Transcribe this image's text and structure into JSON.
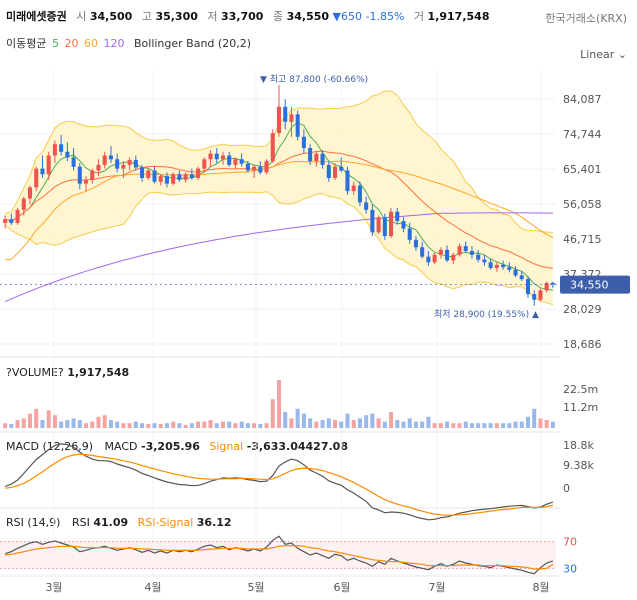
{
  "header": {
    "name": "미래에셋증권",
    "open_label": "시",
    "open": "34,500",
    "high_label": "고",
    "high": "35,300",
    "low_label": "저",
    "low": "33,700",
    "close_label": "종",
    "close": "34,550",
    "change": "▼650 -1.85%",
    "volume_label": "거",
    "volume": "1,917,548",
    "exchange": "한국거래소(KRX)"
  },
  "indicators": {
    "ma_title": "이동평균",
    "ma_periods": [
      "5",
      "20",
      "60",
      "120"
    ],
    "bollinger": "Bollinger Band (20,2)",
    "scale": "Linear",
    "volume_title": "?VOLUME?",
    "volume_value": "1,917,548",
    "macd_title": "MACD (12,26,9)",
    "macd_label": "MACD",
    "macd_value": "-3,205.96",
    "signal_label": "Signal",
    "signal_value": "-3,633.04427.08",
    "rsi_title": "RSI (14,9)",
    "rsi_label": "RSI",
    "rsi_value": "41.09",
    "rsi_signal_label": "RSI-Signal",
    "rsi_signal_value": "36.12"
  },
  "colors": {
    "up": "#ef5350",
    "down": "#2a6fdb",
    "ma5": "#4caf50",
    "ma20": "#ff7043",
    "ma60": "#ffa726",
    "ma120": "#a066f0",
    "band_fill": "#fff3c4",
    "band_line": "#f5cc4a",
    "signal_text": "#ff8a00",
    "price_tag": "#3d5ea8"
  },
  "chart_data": {
    "type": "candlestick",
    "x_labels": [
      "3월",
      "4월",
      "5월",
      "6월",
      "7월",
      "8월"
    ],
    "price_axis": [
      "84,087",
      "74,744",
      "65,401",
      "56,058",
      "46,715",
      "37,372",
      "28,029",
      "18,686"
    ],
    "current_price_tag": "34,550",
    "high_annotation": "▼ 최고 87,800 (-60.66%)",
    "low_annotation": "최저 28,900 (19.55%) ▲",
    "volume_axis": [
      "22.5m",
      "11.2m"
    ],
    "macd_axis": [
      "18.8k",
      "9.38k",
      "0"
    ],
    "rsi_axis": [
      "70",
      "30"
    ],
    "rsi_levels": [
      70,
      30
    ],
    "ylim": [
      18686,
      84087
    ],
    "candles": [
      [
        51000,
        53000,
        49500,
        52000
      ],
      [
        52000,
        53500,
        50500,
        51000
      ],
      [
        51000,
        55000,
        50500,
        54500
      ],
      [
        54500,
        58000,
        53000,
        57500
      ],
      [
        57500,
        61000,
        56000,
        60500
      ],
      [
        60500,
        66000,
        59500,
        65500
      ],
      [
        65500,
        69000,
        63000,
        64000
      ],
      [
        64000,
        70000,
        62500,
        69000
      ],
      [
        69000,
        73000,
        67000,
        72000
      ],
      [
        72000,
        74500,
        69000,
        70000
      ],
      [
        70000,
        72500,
        67500,
        68500
      ],
      [
        68500,
        71000,
        65000,
        66000
      ],
      [
        66000,
        67000,
        60000,
        61500
      ],
      [
        61500,
        63500,
        59500,
        62500
      ],
      [
        62500,
        65500,
        61500,
        65000
      ],
      [
        65000,
        68000,
        63500,
        66500
      ],
      [
        66500,
        70000,
        65500,
        69000
      ],
      [
        69000,
        71500,
        67000,
        68000
      ],
      [
        68000,
        69500,
        64500,
        65500
      ],
      [
        65500,
        67500,
        63000,
        66500
      ],
      [
        66500,
        68500,
        65000,
        67800
      ],
      [
        67800,
        69000,
        65000,
        65800
      ],
      [
        65800,
        66500,
        62000,
        63000
      ],
      [
        63000,
        65500,
        62500,
        65000
      ],
      [
        65000,
        66000,
        61500,
        62000
      ],
      [
        62000,
        64000,
        61000,
        63500
      ],
      [
        63500,
        64500,
        60500,
        61500
      ],
      [
        61500,
        64500,
        61000,
        64000
      ],
      [
        64000,
        65000,
        62000,
        62500
      ],
      [
        62500,
        64500,
        61800,
        64000
      ],
      [
        64000,
        65500,
        62500,
        63000
      ],
      [
        63000,
        66000,
        62500,
        65500
      ],
      [
        65500,
        68500,
        64500,
        68000
      ],
      [
        68000,
        70500,
        66000,
        69500
      ],
      [
        69500,
        71000,
        67000,
        68000
      ],
      [
        68000,
        70000,
        66500,
        69000
      ],
      [
        69000,
        70000,
        66000,
        66500
      ],
      [
        66500,
        68500,
        65500,
        68000
      ],
      [
        68000,
        69500,
        66000,
        66800
      ],
      [
        66800,
        67500,
        64500,
        65000
      ],
      [
        65000,
        66500,
        63000,
        66000
      ],
      [
        66000,
        67500,
        64000,
        64500
      ],
      [
        64500,
        68000,
        64000,
        67500
      ],
      [
        67500,
        76000,
        67000,
        75000
      ],
      [
        75000,
        87800,
        74000,
        82000
      ],
      [
        82000,
        84000,
        76000,
        78000
      ],
      [
        78000,
        82000,
        74000,
        80000
      ],
      [
        80000,
        81000,
        73000,
        74000
      ],
      [
        74000,
        76000,
        69500,
        71000
      ],
      [
        71000,
        72000,
        66500,
        67500
      ],
      [
        67500,
        70000,
        66000,
        69500
      ],
      [
        69500,
        70500,
        65500,
        66500
      ],
      [
        66500,
        67500,
        62000,
        63000
      ],
      [
        63000,
        67000,
        62500,
        66000
      ],
      [
        66000,
        68500,
        64500,
        65000
      ],
      [
        65000,
        66000,
        58500,
        59500
      ],
      [
        59500,
        62000,
        58500,
        61000
      ],
      [
        61000,
        62000,
        55500,
        56500
      ],
      [
        56500,
        58000,
        53500,
        54500
      ],
      [
        54500,
        56000,
        47500,
        48500
      ],
      [
        48500,
        53000,
        48000,
        52500
      ],
      [
        52500,
        53500,
        46500,
        47500
      ],
      [
        47500,
        55000,
        47000,
        54000
      ],
      [
        54000,
        55000,
        50500,
        51500
      ],
      [
        51500,
        52500,
        48500,
        49500
      ],
      [
        49500,
        51000,
        45500,
        46500
      ],
      [
        46500,
        47500,
        43500,
        44500
      ],
      [
        44500,
        46000,
        41500,
        42000
      ],
      [
        42000,
        43500,
        39500,
        40500
      ],
      [
        40500,
        43000,
        40000,
        42500
      ],
      [
        42500,
        44500,
        41500,
        43800
      ],
      [
        43800,
        45000,
        40500,
        41000
      ],
      [
        41000,
        43000,
        40000,
        42500
      ],
      [
        42500,
        45500,
        42000,
        44800
      ],
      [
        44800,
        46000,
        43000,
        43500
      ],
      [
        43500,
        44800,
        41500,
        42500
      ],
      [
        42500,
        43800,
        40500,
        41200
      ],
      [
        41200,
        42500,
        39500,
        40500
      ],
      [
        40500,
        41500,
        38500,
        39000
      ],
      [
        39000,
        40500,
        38000,
        39800
      ],
      [
        39800,
        41000,
        38500,
        39200
      ],
      [
        39200,
        40500,
        37800,
        38500
      ],
      [
        38500,
        39500,
        36500,
        37000
      ],
      [
        37000,
        38200,
        35500,
        36000
      ],
      [
        36000,
        36800,
        31000,
        32000
      ],
      [
        32000,
        33000,
        28900,
        30500
      ],
      [
        30500,
        33500,
        30000,
        33000
      ],
      [
        33000,
        35300,
        32500,
        35000
      ],
      [
        35000,
        35300,
        33700,
        34550
      ]
    ],
    "volume": [
      3,
      2.5,
      5,
      6,
      9,
      12,
      5,
      11,
      8,
      4,
      5,
      6,
      5,
      3,
      4,
      7,
      8,
      5,
      4,
      3,
      3,
      4,
      3,
      2.5,
      3,
      2.5,
      3,
      4,
      3,
      2,
      3,
      4,
      4,
      5,
      3,
      4,
      4,
      3,
      4,
      3,
      3,
      2.5,
      3,
      18,
      30,
      10,
      6,
      12,
      9,
      6,
      4,
      5,
      6,
      5,
      4,
      9,
      5,
      6,
      8,
      9,
      6,
      4,
      10,
      5,
      4,
      6,
      4,
      4,
      7,
      3,
      3,
      4,
      3,
      3,
      4,
      3,
      3,
      3,
      3,
      3,
      3,
      3,
      4,
      4,
      7,
      12,
      6,
      5,
      4
    ],
    "macd": [
      0.6,
      1.2,
      2.2,
      3.8,
      5.5,
      7.2,
      8.4,
      9.6,
      10.6,
      11,
      10.8,
      10.2,
      9,
      8,
      7.3,
      6.9,
      6.9,
      6.7,
      6.1,
      5.6,
      5.2,
      4.6,
      3.8,
      3.3,
      2.7,
      2.2,
      1.7,
      1.4,
      1.1,
      1.0,
      0.8,
      0.9,
      1.3,
      1.9,
      2.3,
      2.7,
      2.6,
      2.7,
      2.6,
      2.3,
      2.1,
      1.8,
      1.9,
      3.3,
      5.6,
      6.6,
      7.3,
      6.9,
      5.9,
      4.6,
      3.9,
      3.1,
      2.0,
      1.4,
      0.9,
      -0.2,
      -1.0,
      -2.0,
      -3.0,
      -4.6,
      -5.1,
      -5.8,
      -5.6,
      -5.7,
      -5.9,
      -6.3,
      -6.8,
      -7.2,
      -7.5,
      -7.4,
      -7.0,
      -6.8,
      -6.4,
      -5.9,
      -5.6,
      -5.3,
      -5.1,
      -4.9,
      -4.8,
      -4.6,
      -4.4,
      -4.2,
      -4.1,
      -4.0,
      -4.3,
      -4.6,
      -4.4,
      -3.7,
      -3.2
    ],
    "signal": [
      0.2,
      0.4,
      0.8,
      1.4,
      2.2,
      3.2,
      4.2,
      5.3,
      6.3,
      7.2,
      7.9,
      8.3,
      8.5,
      8.4,
      8.2,
      7.9,
      7.7,
      7.5,
      7.2,
      6.9,
      6.6,
      6.2,
      5.7,
      5.3,
      4.9,
      4.5,
      4.1,
      3.7,
      3.4,
      3.1,
      2.8,
      2.6,
      2.5,
      2.4,
      2.4,
      2.5,
      2.5,
      2.5,
      2.6,
      2.6,
      2.5,
      2.4,
      2.3,
      2.5,
      3.1,
      3.8,
      4.5,
      4.9,
      5.1,
      5.0,
      4.8,
      4.5,
      4.0,
      3.5,
      3.0,
      2.3,
      1.6,
      0.8,
      0.0,
      -0.9,
      -1.8,
      -2.6,
      -3.2,
      -3.7,
      -4.1,
      -4.5,
      -5.0,
      -5.4,
      -5.8,
      -6.1,
      -6.3,
      -6.4,
      -6.4,
      -6.3,
      -6.2,
      -6.0,
      -5.8,
      -5.6,
      -5.4,
      -5.2,
      -5.0,
      -4.9,
      -4.7,
      -4.5,
      -4.5,
      -4.5,
      -4.5,
      -4.3,
      -4.0
    ],
    "rsi": [
      52,
      55,
      60,
      64,
      68,
      70,
      66,
      69,
      71,
      68,
      65,
      62,
      55,
      57,
      60,
      61,
      63,
      60,
      57,
      59,
      61,
      58,
      54,
      57,
      53,
      56,
      53,
      57,
      55,
      57,
      55,
      59,
      63,
      65,
      61,
      63,
      58,
      61,
      59,
      56,
      59,
      56,
      62,
      72,
      78,
      66,
      68,
      60,
      55,
      50,
      53,
      49,
      45,
      51,
      49,
      42,
      45,
      41,
      38,
      33,
      40,
      36,
      45,
      41,
      38,
      35,
      32,
      30,
      28,
      33,
      37,
      33,
      36,
      41,
      38,
      36,
      34,
      33,
      31,
      35,
      33,
      31,
      29,
      27,
      24,
      22,
      31,
      38,
      41.09
    ],
    "rsi_signal": [
      50,
      51,
      53,
      55,
      57,
      59,
      60,
      61,
      62,
      63,
      63,
      63,
      62,
      61,
      61,
      61,
      61,
      61,
      60,
      60,
      60,
      60,
      59,
      59,
      58,
      58,
      57,
      57,
      57,
      57,
      57,
      57,
      58,
      59,
      59,
      60,
      60,
      60,
      60,
      59,
      59,
      59,
      59,
      61,
      63,
      64,
      64,
      64,
      63,
      61,
      60,
      58,
      56,
      55,
      53,
      51,
      49,
      47,
      45,
      43,
      42,
      41,
      40,
      40,
      39,
      38,
      37,
      36,
      34,
      34,
      34,
      34,
      34,
      35,
      35,
      35,
      35,
      34,
      34,
      34,
      34,
      33,
      33,
      32,
      31,
      29,
      29,
      30,
      36.12
    ]
  }
}
